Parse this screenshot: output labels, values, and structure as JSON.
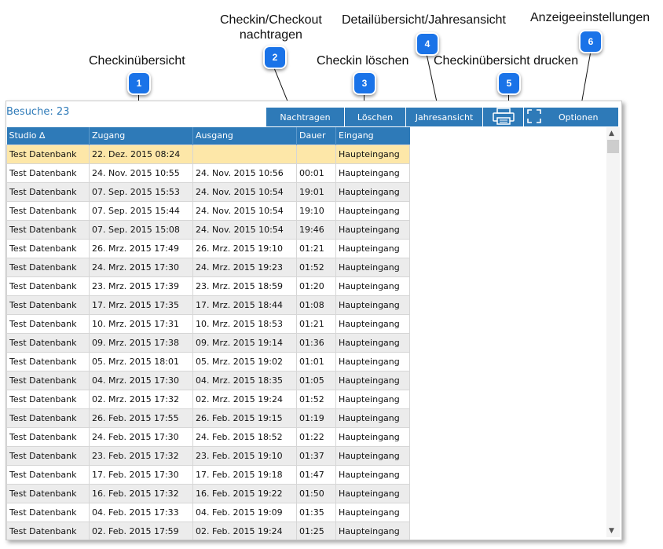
{
  "callouts": [
    {
      "number": "1",
      "label": "Checkinübersicht"
    },
    {
      "number": "2",
      "label": "Checkin/Checkout\nnachtragen"
    },
    {
      "number": "3",
      "label": "Checkin löschen"
    },
    {
      "number": "4",
      "label": "Detailübersicht/Jahresansicht"
    },
    {
      "number": "5",
      "label": "Checkinübersicht drucken"
    },
    {
      "number": "6",
      "label": "Anzeigeeinstellungen"
    }
  ],
  "visits_label": "Besuche: 23",
  "toolbar": {
    "add_label": "Nachtragen",
    "delete_label": "Löschen",
    "year_label": "Jahresansicht",
    "print_icon": "printer-icon",
    "options_icon": "fullscreen-icon",
    "options_label": "Optionen"
  },
  "table": {
    "headers": [
      "Studio ∆",
      "Zugang",
      "Ausgang",
      "Dauer",
      "Eingang"
    ],
    "rows": [
      [
        "Test Datenbank",
        "22. Dez. 2015 08:24",
        "",
        "",
        "Haupteingang"
      ],
      [
        "Test Datenbank",
        "24. Nov. 2015 10:55",
        "24. Nov. 2015 10:56",
        "00:01",
        "Haupteingang"
      ],
      [
        "Test Datenbank",
        "07. Sep. 2015 15:53",
        "24. Nov. 2015 10:54",
        "19:01",
        "Haupteingang"
      ],
      [
        "Test Datenbank",
        "07. Sep. 2015 15:44",
        "24. Nov. 2015 10:54",
        "19:10",
        "Haupteingang"
      ],
      [
        "Test Datenbank",
        "07. Sep. 2015 15:08",
        "24. Nov. 2015 10:54",
        "19:46",
        "Haupteingang"
      ],
      [
        "Test Datenbank",
        "26. Mrz. 2015 17:49",
        "26. Mrz. 2015 19:10",
        "01:21",
        "Haupteingang"
      ],
      [
        "Test Datenbank",
        "24. Mrz. 2015 17:30",
        "24. Mrz. 2015 19:23",
        "01:52",
        "Haupteingang"
      ],
      [
        "Test Datenbank",
        "23. Mrz. 2015 17:39",
        "23. Mrz. 2015 18:59",
        "01:20",
        "Haupteingang"
      ],
      [
        "Test Datenbank",
        "17. Mrz. 2015 17:35",
        "17. Mrz. 2015 18:44",
        "01:08",
        "Haupteingang"
      ],
      [
        "Test Datenbank",
        "10. Mrz. 2015 17:31",
        "10. Mrz. 2015 18:53",
        "01:21",
        "Haupteingang"
      ],
      [
        "Test Datenbank",
        "09. Mrz. 2015 17:38",
        "09. Mrz. 2015 19:14",
        "01:36",
        "Haupteingang"
      ],
      [
        "Test Datenbank",
        "05. Mrz. 2015 18:01",
        "05. Mrz. 2015 19:02",
        "01:01",
        "Haupteingang"
      ],
      [
        "Test Datenbank",
        "04. Mrz. 2015 17:30",
        "04. Mrz. 2015 18:35",
        "01:05",
        "Haupteingang"
      ],
      [
        "Test Datenbank",
        "02. Mrz. 2015 17:32",
        "02. Mrz. 2015 19:24",
        "01:52",
        "Haupteingang"
      ],
      [
        "Test Datenbank",
        "26. Feb. 2015 17:55",
        "26. Feb. 2015 19:15",
        "01:19",
        "Haupteingang"
      ],
      [
        "Test Datenbank",
        "24. Feb. 2015 17:30",
        "24. Feb. 2015 18:52",
        "01:22",
        "Haupteingang"
      ],
      [
        "Test Datenbank",
        "23. Feb. 2015 17:32",
        "23. Feb. 2015 19:10",
        "01:37",
        "Haupteingang"
      ],
      [
        "Test Datenbank",
        "17. Feb. 2015 17:30",
        "17. Feb. 2015 19:18",
        "01:47",
        "Haupteingang"
      ],
      [
        "Test Datenbank",
        "16. Feb. 2015 17:32",
        "16. Feb. 2015 19:22",
        "01:50",
        "Haupteingang"
      ],
      [
        "Test Datenbank",
        "04. Feb. 2015 17:33",
        "04. Feb. 2015 19:09",
        "01:35",
        "Haupteingang"
      ],
      [
        "Test Datenbank",
        "02. Feb. 2015 17:59",
        "02. Feb. 2015 19:24",
        "01:25",
        "Haupteingang"
      ]
    ]
  },
  "colors": {
    "accent": "#2e7ab8",
    "callout_badge": "#1a73e8",
    "selected_row": "#fde7a8",
    "alt_row": "#ececec"
  }
}
